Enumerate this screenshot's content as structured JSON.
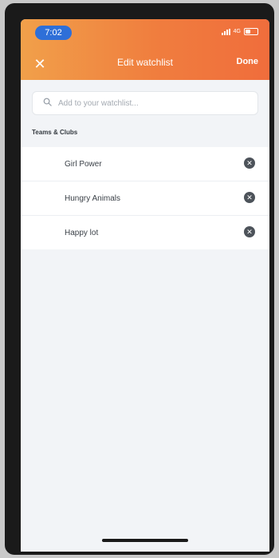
{
  "status_bar": {
    "time": "7:02",
    "network": "4G"
  },
  "header": {
    "title": "Edit watchlist",
    "close_label": "✕",
    "done_label": "Done",
    "gradient_start": "#f1a04a",
    "gradient_end": "#f06d3c"
  },
  "search": {
    "placeholder": "Add to your watchlist...",
    "icon": "search-icon"
  },
  "section": {
    "title": "Teams & Clubs"
  },
  "items": [
    {
      "label": "Girl Power",
      "remove_icon": "remove-circle-icon"
    },
    {
      "label": "Hungry Animals",
      "remove_icon": "remove-circle-icon"
    },
    {
      "label": "Happy lot",
      "remove_icon": "remove-circle-icon"
    }
  ]
}
